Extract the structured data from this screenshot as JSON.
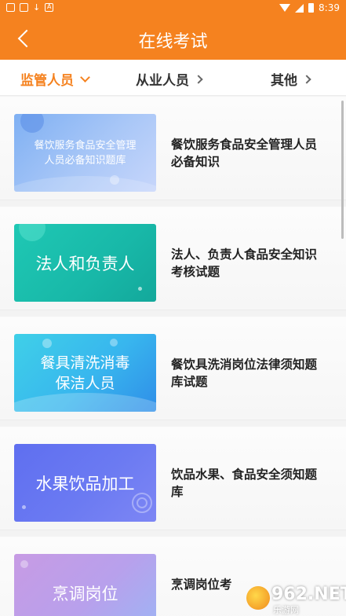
{
  "status_bar": {
    "time": "8:39"
  },
  "header": {
    "title": "在线考试"
  },
  "tabs": [
    {
      "label": "监管人员"
    },
    {
      "label": "从业人员"
    },
    {
      "label": "其他"
    }
  ],
  "items": [
    {
      "thumb_text": "餐饮服务食品安全管理人员必备知识题库",
      "title": "餐饮服务食品安全管理人员必备知识"
    },
    {
      "thumb_text": "法人和负责人",
      "title": "法人、负责人食品安全知识考核试题"
    },
    {
      "thumb_text": "餐具清洗消毒保洁人员",
      "title": "餐饮具洗消岗位法律须知题库试题"
    },
    {
      "thumb_text": "水果饮品加工",
      "title": "饮品水果、食品安全须知题库"
    },
    {
      "thumb_text": "烹调岗位",
      "title": "烹调岗位考"
    }
  ],
  "watermark": {
    "brand": "962.NET",
    "sub": "乐游网"
  },
  "colors": {
    "accent": "#f5821f"
  }
}
